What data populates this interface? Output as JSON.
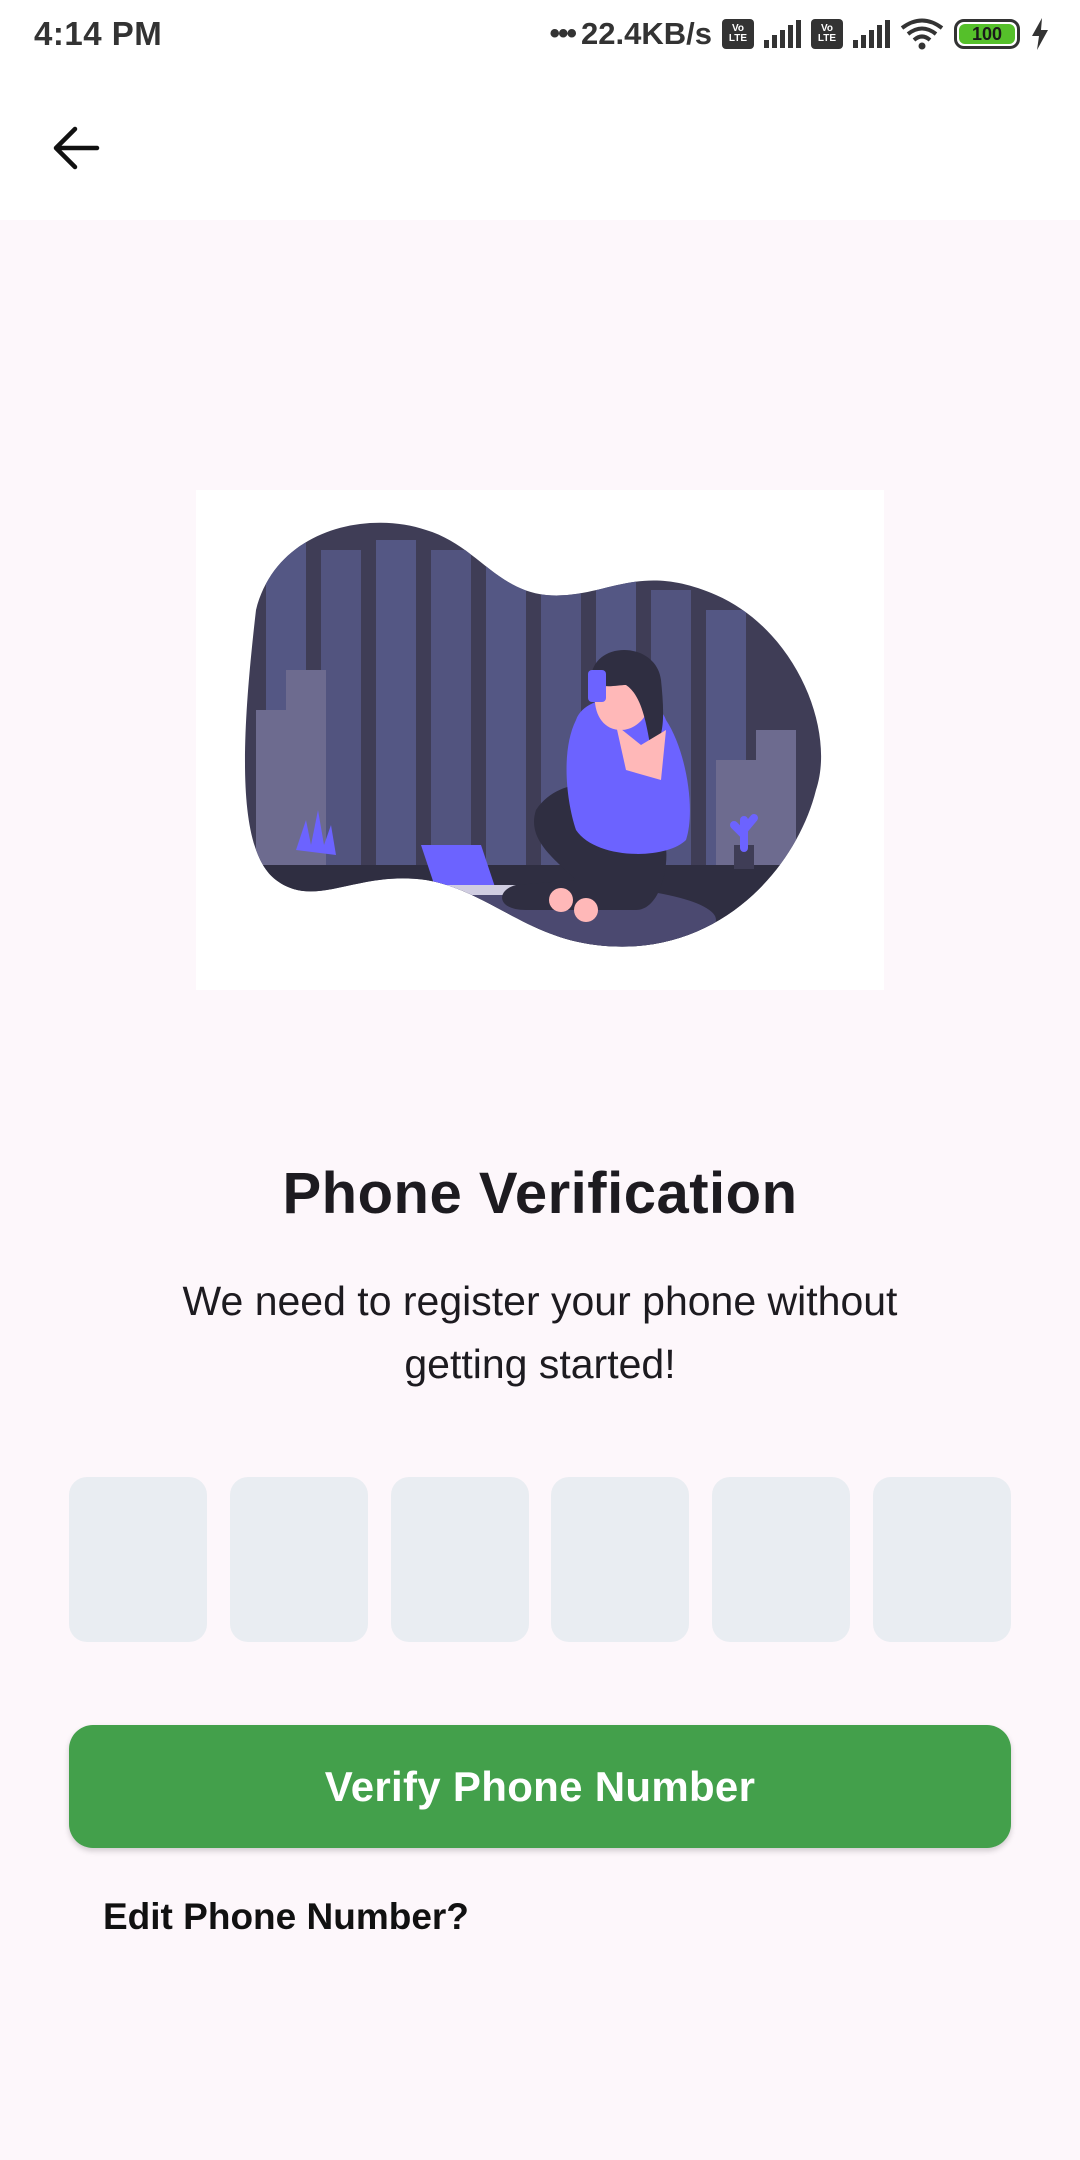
{
  "status_bar": {
    "time": "4:14 PM",
    "net_speed": "22.4KB/s",
    "volte_label_top": "Vo",
    "volte_label_bottom": "LTE",
    "battery_level": "100",
    "icons": [
      "dots-icon",
      "volte-icon",
      "signal-icon",
      "wifi-icon",
      "battery-icon",
      "charging-icon"
    ]
  },
  "app_bar": {
    "back_icon": "arrow-left-icon"
  },
  "illustration": {
    "icon": "woman-on-phone-illustration",
    "colors": {
      "accent": "#6c63ff",
      "background": "#3f3d56",
      "skin": "#ffb8b8"
    }
  },
  "content": {
    "title": "Phone Verification",
    "subtitle": "We need to register your phone without getting started!",
    "otp_digits": [
      "",
      "",
      "",
      "",
      "",
      ""
    ],
    "verify_label": "Verify Phone Number",
    "edit_label": "Edit Phone Number?"
  },
  "colors": {
    "primary": "#43a04b",
    "background": "#fdf7fb",
    "otp_box": "#e9edf2"
  }
}
